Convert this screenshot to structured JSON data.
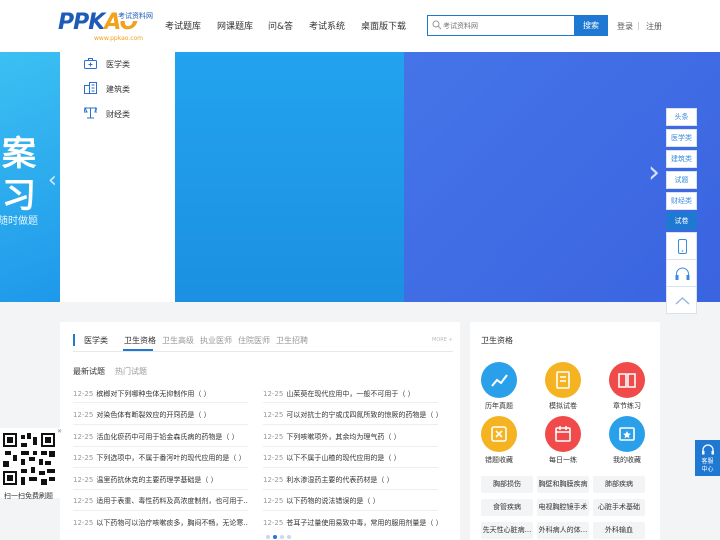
{
  "header": {
    "logo_main": "PPK",
    "logo_tail": "AO",
    "logo_tagline": "考试资料网",
    "logo_url": "www.ppkao.com",
    "nav": [
      "考试题库",
      "网课题库",
      "问&答",
      "考试系统",
      "桌面版下载"
    ],
    "search_placeholder": "考试资料网",
    "search_button": "搜索",
    "login": "登录",
    "separator": "|",
    "register": "注册"
  },
  "banner": {
    "char1": "案",
    "char2": "习",
    "slogan": "随时做题",
    "arrow_left": "‹",
    "arrow_right": "›"
  },
  "categories": [
    {
      "label": "医学类",
      "icon": "medical-kit-icon"
    },
    {
      "label": "建筑类",
      "icon": "building-icon"
    },
    {
      "label": "财经类",
      "icon": "finance-icon"
    }
  ],
  "side_tabs": [
    "头条",
    "医学类",
    "建筑类",
    "试题",
    "财经类",
    "试卷"
  ],
  "content": {
    "section": "医学类",
    "tabs": [
      "卫生资格",
      "卫生高级",
      "执业医师",
      "住院医师",
      "卫生招聘"
    ],
    "more": "MORE +",
    "subtabs": [
      "最新试题",
      "热门试题"
    ],
    "questions_left": [
      {
        "date": "12-25",
        "text": "槟榔对下列哪种虫体无抑制作用（ ）"
      },
      {
        "date": "12-25",
        "text": "对染色体有断裂效应的开窍药是（ ）"
      },
      {
        "date": "12-25",
        "text": "活血化瘀药中可用于铅金森氏病的药物是（ ）"
      },
      {
        "date": "12-25",
        "text": "下列选项中，不属于番泻叶的现代应用的是（ ）"
      },
      {
        "date": "12-25",
        "text": "温里药抗休克的主要药理学基础是（ ）"
      },
      {
        "date": "12-25",
        "text": "适用于表重、毒性药料及高浓度制剂，也可用于..."
      },
      {
        "date": "12-25",
        "text": "以下药物可以治疗咳嗽痰多，胸闷不畅，无论寒..."
      }
    ],
    "questions_right": [
      {
        "date": "12-25",
        "text": "山茱萸在现代应用中，一般不可用于（ ）"
      },
      {
        "date": "12-25",
        "text": "可以对抗士的宁或戊四氮所致的惊厥的药物是（ ）"
      },
      {
        "date": "12-25",
        "text": "下列咳嗽项外，其余均为理气药（ ）"
      },
      {
        "date": "12-25",
        "text": "以下不属于山楂的现代应用的是（ ）"
      },
      {
        "date": "12-25",
        "text": "利水渗湿药主要的代表药材是（ ）"
      },
      {
        "date": "12-25",
        "text": "以下药物的说法错误的是（ ）"
      },
      {
        "date": "12-25",
        "text": "苍耳子过量使用易致中毒，常用的服用剂量是（ ）"
      }
    ]
  },
  "right_panel": {
    "title": "卫生资格",
    "functions": [
      {
        "label": "历年真题",
        "color": "#2aa0ea"
      },
      {
        "label": "模拟试卷",
        "color": "#f5b321"
      },
      {
        "label": "章节练习",
        "color": "#f04a4a"
      },
      {
        "label": "错题收藏",
        "color": "#f5b321"
      },
      {
        "label": "每日一练",
        "color": "#f04a4a"
      },
      {
        "label": "我的收藏",
        "color": "#2aa0ea"
      }
    ],
    "chips": [
      "胸部损伤",
      "胸壁和胸膜疾病",
      "肺部疾病",
      "食管疾病",
      "电视胸腔镜手术",
      "心脏手术基础",
      "先天性心脏病...",
      "外科病人的体...",
      "外科输血"
    ]
  },
  "qr": {
    "label": "扫一扫免费刷题",
    "close": "✕"
  },
  "kefu": {
    "line1": "客服",
    "line2": "中心"
  }
}
